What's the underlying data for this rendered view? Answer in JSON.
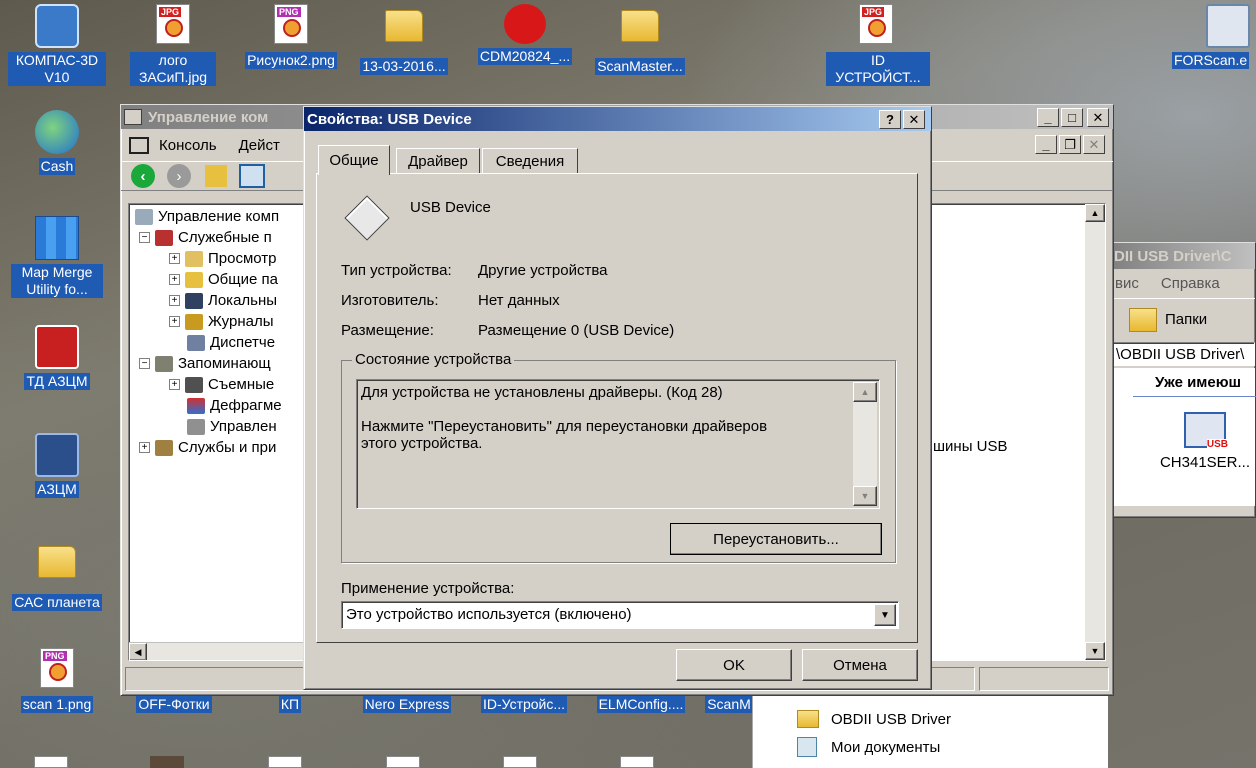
{
  "desktop": {
    "icons": [
      {
        "label": "КОМПАС-3D V10"
      },
      {
        "label": "лого ЗАСиП.jpg",
        "badge": "JPG"
      },
      {
        "label": "Рисунок2.png",
        "badge": "PNG"
      },
      {
        "label": "13-03-2016..."
      },
      {
        "label": "CDM20824_..."
      },
      {
        "label": "ScanMaster..."
      },
      {
        "label": "ID УСТРОЙСТ...",
        "badge": "JPG"
      },
      {
        "label": "FORScan.e"
      },
      {
        "label": "Cash"
      },
      {
        "label": "Map Merge Utility fo..."
      },
      {
        "label": "ТД АЗЦМ"
      },
      {
        "label": "АЗЦМ"
      },
      {
        "label": "САС планета"
      },
      {
        "label": "scan 1.png",
        "badge": "PNG"
      },
      {
        "label": "OFF-Фотки"
      },
      {
        "label": "КП"
      },
      {
        "label": "Nero Express"
      },
      {
        "label": "ID-Устройс..."
      },
      {
        "label": "ELMConfig...."
      },
      {
        "label": "ScanM"
      }
    ]
  },
  "mmc": {
    "title": "Управление ком",
    "menu": [
      "Консоль",
      "Дейст"
    ],
    "tree": [
      {
        "label": "Управление комп"
      },
      {
        "label": "Служебные п"
      },
      {
        "label": "Просмотр"
      },
      {
        "label": "Общие па"
      },
      {
        "label": "Локальны"
      },
      {
        "label": "Журналы"
      },
      {
        "label": "Диспетче"
      },
      {
        "label": "Запоминающ"
      },
      {
        "label": "Съемные"
      },
      {
        "label": "Дефрагме"
      },
      {
        "label": "Управлен"
      },
      {
        "label": "Службы и при"
      }
    ],
    "right_pane_text": "шины USB"
  },
  "explorer": {
    "title": "DII USB Driver\\C",
    "menu": [
      "вис",
      "Справка"
    ],
    "folders_button": "Папки",
    "address": "\\OBDII USB Driver\\",
    "heading": "Уже имеюш",
    "file": {
      "label": "CH341SER...",
      "badge": "USB"
    },
    "list": [
      {
        "label": "OBDII USB Driver"
      },
      {
        "label": "Мои документы"
      }
    ]
  },
  "dialog": {
    "title": "Свойства: USB Device",
    "help_btn": "?",
    "close_btn": "✕",
    "tabs": [
      {
        "label": "Общие",
        "active": true
      },
      {
        "label": "Драйвер",
        "active": false
      },
      {
        "label": "Сведения",
        "active": false
      }
    ],
    "device_name": "USB Device",
    "props": [
      {
        "key": "Тип устройства:",
        "value": "Другие устройства"
      },
      {
        "key": "Изготовитель:",
        "value": "Нет данных"
      },
      {
        "key": "Размещение:",
        "value": "Размещение 0 (USB Device)"
      }
    ],
    "status_group": "Состояние устройства",
    "status_line1": "Для устройства не установлены драйверы. (Код 28)",
    "status_line2": "Нажмите \"Переустановить\" для переустановки драйверов",
    "status_line3": "этого устройства.",
    "reinstall_btn": "Переустановить...",
    "usage_label": "Применение устройства:",
    "usage_value": "Это устройство используется (включено)",
    "ok_btn": "OK",
    "cancel_btn": "Отмена"
  }
}
